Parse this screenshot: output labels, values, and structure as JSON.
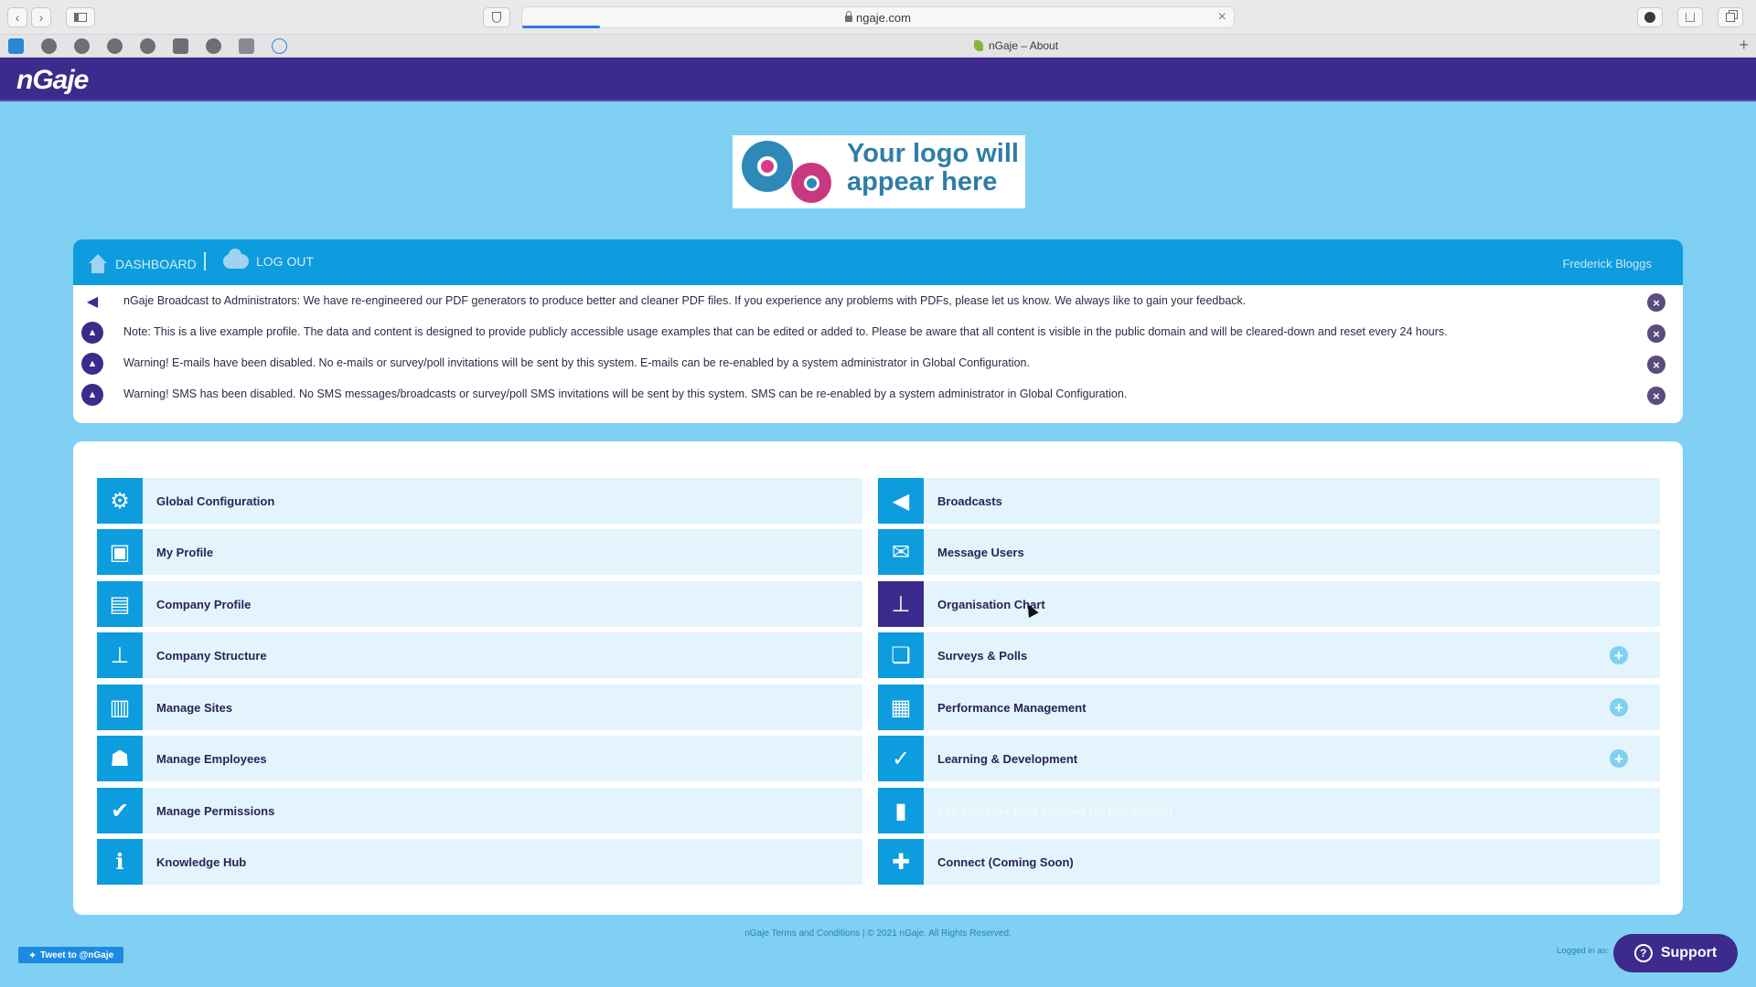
{
  "browser": {
    "url": "ngaje.com",
    "tab_title": "nGaje – About",
    "back_icon": "‹",
    "forward_icon": "›",
    "close_icon": "×",
    "new_tab_icon": "+"
  },
  "header": {
    "brand": "nGaje"
  },
  "logo": {
    "line1": "Your logo will",
    "line2": "appear here"
  },
  "nav": {
    "dashboard": "DASHBOARD",
    "logout": "LOG OUT",
    "user": "Frederick Bloggs"
  },
  "alerts": [
    {
      "icon": "megaphone-icon",
      "text": "nGaje Broadcast to Administrators: We have re-engineered our PDF generators to produce better and cleaner PDF files. If you experience any problems with PDFs, please let us know. We always like to gain your feedback."
    },
    {
      "icon": "warning-icon",
      "text": "Note: This is a live example profile. The data and content is designed to provide publicly accessible usage examples that can be edited or added to. Please be aware that all content is visible in the public domain and will be cleared-down and reset every 24 hours."
    },
    {
      "icon": "warning-icon",
      "text": "Warning! E-mails have been disabled. No e-mails or survey/poll invitations will be sent by this system. E-mails can be re-enabled by a system administrator in Global Configuration."
    },
    {
      "icon": "warning-icon",
      "text": "Warning! SMS has been disabled. No SMS messages/broadcasts or survey/poll SMS invitations will be sent by this system. SMS can be re-enabled by a system administrator in Global Configuration."
    }
  ],
  "menu": {
    "left": [
      {
        "label": "Global Configuration",
        "icon": "⚙"
      },
      {
        "label": "My Profile",
        "icon": "▣"
      },
      {
        "label": "Company Profile",
        "icon": "▤"
      },
      {
        "label": "Company Structure",
        "icon": "⊥"
      },
      {
        "label": "Manage Sites",
        "icon": "▥"
      },
      {
        "label": "Manage Employees",
        "icon": "☗"
      },
      {
        "label": "Manage Permissions",
        "icon": "✔"
      },
      {
        "label": "Knowledge Hub",
        "icon": "ℹ"
      }
    ],
    "right": [
      {
        "label": "Broadcasts",
        "icon": "◀"
      },
      {
        "label": "Message Users",
        "icon": "✉"
      },
      {
        "label": "Organisation Chart",
        "icon": "⊥"
      },
      {
        "label": "Surveys & Polls",
        "icon": "❏"
      },
      {
        "label": "Performance Management",
        "icon": "▦"
      },
      {
        "label": "Learning & Development",
        "icon": "✓"
      },
      {
        "label": "File Manager (Not enabled for this profile)",
        "icon": "▮"
      },
      {
        "label": "Connect (Coming Soon)",
        "icon": "✚"
      }
    ],
    "expand_icon": "+"
  },
  "footer": {
    "text": "nGaje Terms and Conditions  |  © 2021 nGaje. All Rights Reserved.",
    "tweet": "Tweet to @nGaje",
    "logged_in": "Logged in as:",
    "support": "Support",
    "support_icon": "?"
  },
  "colors": {
    "page_bg": "#7fd0f2",
    "header_purple": "#3c2a8c",
    "nav_blue": "#0d9cde",
    "tile_bg": "#e3f4fc"
  }
}
